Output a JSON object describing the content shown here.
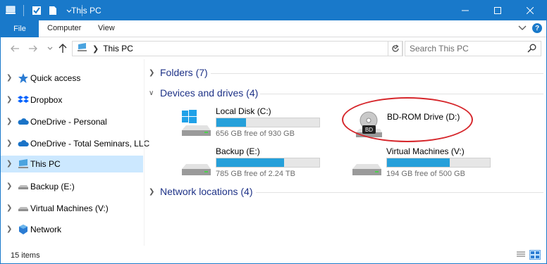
{
  "window": {
    "title": "This PC",
    "controls": [
      "minimize-icon",
      "maximize-icon",
      "close-icon"
    ],
    "accent_color": "#1979ca"
  },
  "ribbon": {
    "file_tab": "File",
    "tabs": [
      "Computer",
      "View"
    ]
  },
  "address": {
    "location": "This PC",
    "search_placeholder": "Search This PC"
  },
  "nav_pane": {
    "items": [
      {
        "label": "Quick access",
        "icon": "star-icon"
      },
      {
        "label": "Dropbox",
        "icon": "dropbox-icon"
      },
      {
        "label": "OneDrive - Personal",
        "icon": "cloud-icon"
      },
      {
        "label": "OneDrive - Total Seminars, LLC",
        "icon": "cloud-icon"
      },
      {
        "label": "This PC",
        "icon": "computer-icon",
        "selected": true
      },
      {
        "label": "Backup (E:)",
        "icon": "drive-icon"
      },
      {
        "label": "Virtual Machines (V:)",
        "icon": "drive-icon"
      },
      {
        "label": "Network",
        "icon": "network-icon"
      }
    ]
  },
  "content": {
    "groups": [
      {
        "title": "Folders (7)",
        "expanded": false
      },
      {
        "title": "Devices and drives (4)",
        "expanded": true
      },
      {
        "title": "Network locations (4)",
        "expanded": false
      }
    ],
    "drives": [
      {
        "name": "Local Disk (C:)",
        "free_text": "656 GB free of 930 GB",
        "used_fraction": 0.29,
        "icon": "windows-drive-icon"
      },
      {
        "name": "BD-ROM Drive (D:)",
        "free_text": "",
        "used_fraction": null,
        "icon": "optical-drive-icon",
        "disc_label": "BD",
        "highlighted": true
      },
      {
        "name": "Backup (E:)",
        "free_text": "785 GB free of 2.24 TB",
        "used_fraction": 0.66,
        "icon": "hard-drive-icon"
      },
      {
        "name": "Virtual Machines (V:)",
        "free_text": "194 GB free of 500 GB",
        "used_fraction": 0.61,
        "icon": "hard-drive-icon"
      }
    ],
    "bar_color": "#26a0da",
    "highlight_color": "#d6262b"
  },
  "status": {
    "item_count": "15 items"
  }
}
